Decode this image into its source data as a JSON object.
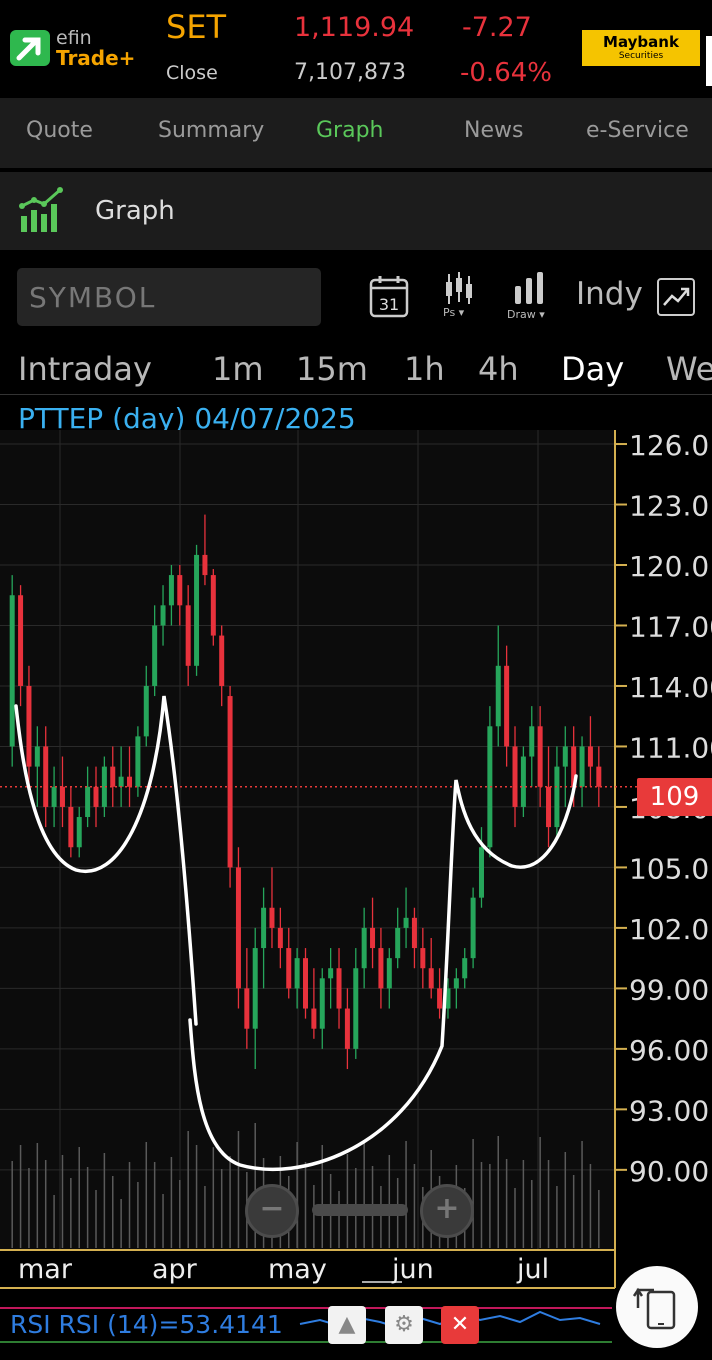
{
  "header": {
    "logo_line1": "efin",
    "logo_line2": "Trade+",
    "index_name": "SET",
    "close_label": "Close",
    "index_value": "1,119.94",
    "volume": "7,107,873",
    "change": "-7.27",
    "change_pct": "-0.64%",
    "broker_name": "Maybank",
    "broker_sub": "Securities"
  },
  "tabs": [
    "Quote",
    "Summary",
    "Graph",
    "News",
    "e-Service"
  ],
  "active_tab": "Graph",
  "section_title": "Graph",
  "toolbar": {
    "symbol_placeholder": "SYMBOL",
    "calendar_day": "31",
    "ps_label": "Ps ▾",
    "draw_label": "Draw ▾",
    "indy_label": "Indy"
  },
  "periods": [
    "Intraday",
    "1m",
    "15m",
    "1h",
    "4h",
    "Day",
    "We"
  ],
  "active_period": "Day",
  "chart_label": "PTTEP (day) 04/07/2025",
  "current_price": "109",
  "rsi_label": "RSI RSI (14)=53.4141",
  "colors": {
    "up": "#26a65b",
    "down": "#e8323c",
    "neutral": "#d4a020",
    "accent": "#5ac85a",
    "axis": "#d4b050"
  },
  "chart_data": {
    "type": "candlestick",
    "title": "PTTEP (day) 04/07/2025",
    "y_ticks": [
      "126.0",
      "123.0",
      "120.0",
      "117.00",
      "114.00",
      "111.00",
      "108.0",
      "105.0",
      "102.0",
      "99.00",
      "96.00",
      "93.00",
      "90.00"
    ],
    "x_ticks": [
      "mar",
      "apr",
      "may",
      "jun",
      "jul"
    ],
    "ylim": [
      89,
      126.2
    ],
    "current_price": 109,
    "candles": [
      {
        "o": 111,
        "h": 119.5,
        "l": 110,
        "c": 118.5
      },
      {
        "o": 118.5,
        "h": 119,
        "l": 113,
        "c": 114
      },
      {
        "o": 114,
        "h": 115,
        "l": 109,
        "c": 110
      },
      {
        "o": 110,
        "h": 112,
        "l": 108,
        "c": 111
      },
      {
        "o": 111,
        "h": 112,
        "l": 107,
        "c": 108
      },
      {
        "o": 108,
        "h": 110,
        "l": 107,
        "c": 109
      },
      {
        "o": 109,
        "h": 110.5,
        "l": 107,
        "c": 108
      },
      {
        "o": 108,
        "h": 109,
        "l": 105.5,
        "c": 106
      },
      {
        "o": 106,
        "h": 108,
        "l": 105.5,
        "c": 107.5
      },
      {
        "o": 107.5,
        "h": 110,
        "l": 107,
        "c": 109
      },
      {
        "o": 109,
        "h": 110,
        "l": 107,
        "c": 108
      },
      {
        "o": 108,
        "h": 110.5,
        "l": 107.5,
        "c": 110
      },
      {
        "o": 110,
        "h": 111,
        "l": 108,
        "c": 109
      },
      {
        "o": 109,
        "h": 111,
        "l": 108,
        "c": 109.5
      },
      {
        "o": 109.5,
        "h": 111,
        "l": 108,
        "c": 109
      },
      {
        "o": 109,
        "h": 112,
        "l": 108.5,
        "c": 111.5
      },
      {
        "o": 111.5,
        "h": 115,
        "l": 111,
        "c": 114
      },
      {
        "o": 114,
        "h": 118,
        "l": 113.5,
        "c": 117
      },
      {
        "o": 117,
        "h": 119,
        "l": 116,
        "c": 118
      },
      {
        "o": 118,
        "h": 120,
        "l": 117,
        "c": 119.5
      },
      {
        "o": 119.5,
        "h": 120,
        "l": 117,
        "c": 118
      },
      {
        "o": 118,
        "h": 119,
        "l": 114,
        "c": 115
      },
      {
        "o": 115,
        "h": 121,
        "l": 114.5,
        "c": 120.5
      },
      {
        "o": 120.5,
        "h": 122.5,
        "l": 119,
        "c": 119.5
      },
      {
        "o": 119.5,
        "h": 119.8,
        "l": 116,
        "c": 116.5
      },
      {
        "o": 116.5,
        "h": 117,
        "l": 113,
        "c": 114
      },
      {
        "o": 113.5,
        "h": 114,
        "l": 104,
        "c": 105
      },
      {
        "o": 105,
        "h": 106,
        "l": 98,
        "c": 99
      },
      {
        "o": 99,
        "h": 101,
        "l": 96,
        "c": 97
      },
      {
        "o": 97,
        "h": 102,
        "l": 95,
        "c": 101
      },
      {
        "o": 101,
        "h": 104,
        "l": 99,
        "c": 103
      },
      {
        "o": 103,
        "h": 105,
        "l": 101,
        "c": 102
      },
      {
        "o": 102,
        "h": 103,
        "l": 100,
        "c": 101
      },
      {
        "o": 101,
        "h": 102,
        "l": 98.5,
        "c": 99
      },
      {
        "o": 99,
        "h": 101,
        "l": 98,
        "c": 100.5
      },
      {
        "o": 100.5,
        "h": 101,
        "l": 97.5,
        "c": 98
      },
      {
        "o": 98,
        "h": 100,
        "l": 96.5,
        "c": 97
      },
      {
        "o": 97,
        "h": 100,
        "l": 96,
        "c": 99.5
      },
      {
        "o": 99.5,
        "h": 101,
        "l": 98,
        "c": 100
      },
      {
        "o": 100,
        "h": 101,
        "l": 97,
        "c": 98
      },
      {
        "o": 98,
        "h": 99,
        "l": 95,
        "c": 96
      },
      {
        "o": 96,
        "h": 101,
        "l": 95.5,
        "c": 100
      },
      {
        "o": 100,
        "h": 103,
        "l": 99,
        "c": 102
      },
      {
        "o": 102,
        "h": 103.5,
        "l": 100,
        "c": 101
      },
      {
        "o": 101,
        "h": 102,
        "l": 98,
        "c": 99
      },
      {
        "o": 99,
        "h": 101,
        "l": 98,
        "c": 100.5
      },
      {
        "o": 100.5,
        "h": 103,
        "l": 100,
        "c": 102
      },
      {
        "o": 102,
        "h": 104,
        "l": 101,
        "c": 102.5
      },
      {
        "o": 102.5,
        "h": 103,
        "l": 100,
        "c": 101
      },
      {
        "o": 101,
        "h": 102,
        "l": 99,
        "c": 100
      },
      {
        "o": 100,
        "h": 101.5,
        "l": 98.5,
        "c": 99
      },
      {
        "o": 99,
        "h": 100,
        "l": 97.5,
        "c": 98
      },
      {
        "o": 98,
        "h": 99.5,
        "l": 97.5,
        "c": 99
      },
      {
        "o": 99,
        "h": 100,
        "l": 98,
        "c": 99.5
      },
      {
        "o": 99.5,
        "h": 101,
        "l": 99,
        "c": 100.5
      },
      {
        "o": 100.5,
        "h": 104,
        "l": 100,
        "c": 103.5
      },
      {
        "o": 103.5,
        "h": 107,
        "l": 103,
        "c": 106
      },
      {
        "o": 106,
        "h": 113,
        "l": 105.5,
        "c": 112
      },
      {
        "o": 112,
        "h": 117,
        "l": 111,
        "c": 115
      },
      {
        "o": 115,
        "h": 116,
        "l": 110,
        "c": 111
      },
      {
        "o": 111,
        "h": 112,
        "l": 107,
        "c": 108
      },
      {
        "o": 108,
        "h": 111,
        "l": 107.5,
        "c": 110.5
      },
      {
        "o": 110.5,
        "h": 113,
        "l": 109,
        "c": 112
      },
      {
        "o": 112,
        "h": 113,
        "l": 108,
        "c": 109
      },
      {
        "o": 109,
        "h": 111,
        "l": 106,
        "c": 107
      },
      {
        "o": 107,
        "h": 111,
        "l": 106.5,
        "c": 110
      },
      {
        "o": 110,
        "h": 112,
        "l": 108,
        "c": 111
      },
      {
        "o": 111,
        "h": 112,
        "l": 108,
        "c": 109
      },
      {
        "o": 109,
        "h": 111.5,
        "l": 108,
        "c": 111
      },
      {
        "o": 111,
        "h": 112.5,
        "l": 109,
        "c": 110
      },
      {
        "o": 110,
        "h": 111,
        "l": 108,
        "c": 109
      }
    ]
  }
}
